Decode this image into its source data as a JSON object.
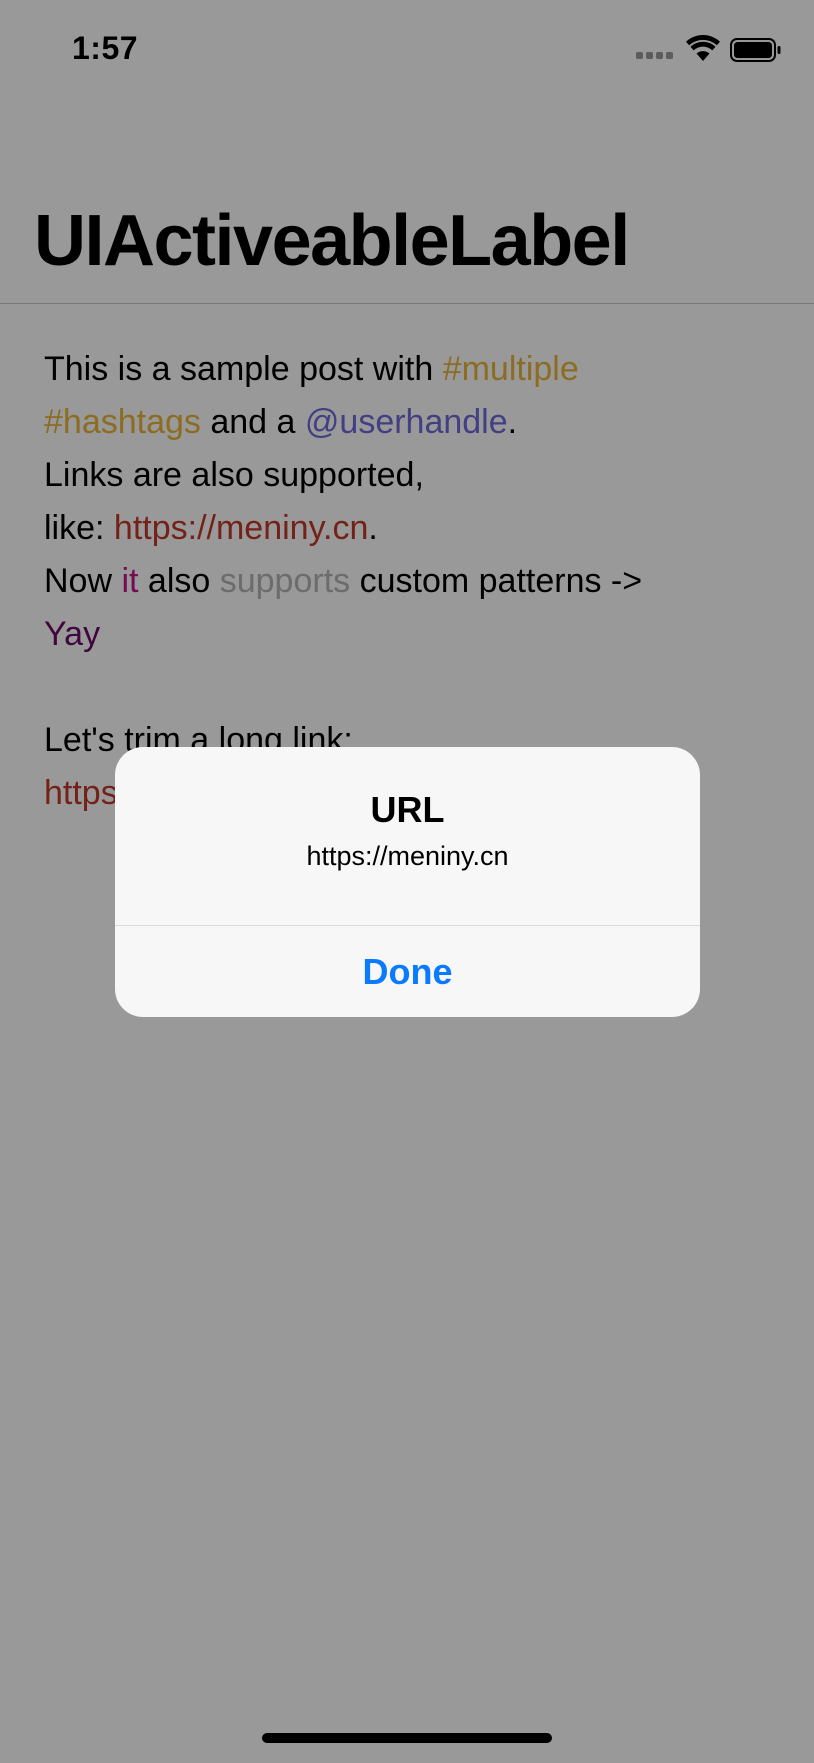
{
  "status_bar": {
    "time": "1:57",
    "icons": [
      "cellular-signal-icon",
      "wifi-icon",
      "battery-icon"
    ]
  },
  "nav": {
    "title": "UIActiveableLabel"
  },
  "content": {
    "line1": {
      "text": "This is a sample post with ",
      "hashtag": "#multiple"
    },
    "line2": {
      "hashtag": "#hashtags",
      "text": " and a ",
      "mention": "@userhandle",
      "end": "."
    },
    "line3": {
      "text": "Links are also supported,"
    },
    "line4": {
      "text": "like: ",
      "url": "https://meniny.cn",
      "end": "."
    },
    "line5": {
      "text1": "Now ",
      "it": "it",
      "text2": " also ",
      "supports": "supports",
      "text3": " custom patterns ->"
    },
    "line6": {
      "yay": "Yay"
    },
    "line8": {
      "text": "Let's trim a long link:"
    },
    "line9": {
      "url_start": "https"
    }
  },
  "colors": {
    "hashtag": "#e8b53a",
    "mention": "#6f6bd9",
    "url": "#c0392b",
    "custom_it": "#c0138e",
    "custom_supports": "#b4b4b4",
    "custom_yay": "#6a0c66",
    "alert_button": "#0a7aff",
    "overlay": "rgba(0,0,0,0.40)"
  },
  "alert": {
    "title": "URL",
    "message": "https://meniny.cn",
    "button_label": "Done"
  }
}
